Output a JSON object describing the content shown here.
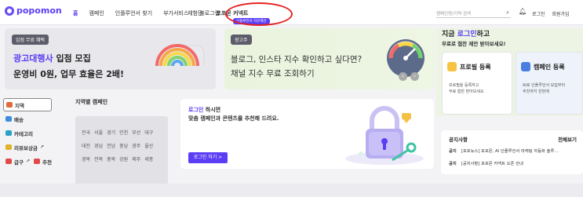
{
  "header": {
    "logo": "popomon",
    "nav": [
      "홈",
      "캠페인",
      "인플루언서 찾기",
      "부가서비스",
      "블로그랩",
      "체험단",
      "포포몬 커넥트"
    ],
    "sub_pill": "인플루언서 자유제안",
    "search_placeholder": "캠페인명/지역 검색",
    "links": [
      "로그인",
      "회원가입"
    ]
  },
  "banner1": {
    "tag": "입점 무료 혜택",
    "line1_accent": "광고대행사",
    "line1_rest": " 입점 모집",
    "line2": "운영비 0원, 업무 효율은 2배!"
  },
  "banner2": {
    "tag": "광고주",
    "line1": "블로그, 인스타 지수 확인하고 싶다면?",
    "line2": "채널 지수 무료 조회하기"
  },
  "right": {
    "title_pre": "지금 ",
    "title_accent": "로그인",
    "title_post": "하고",
    "subtitle": "무료로 협찬 제안 받아보세요!",
    "profile_card": {
      "title": "프로필 등록",
      "desc1": "프로필을 등록하고",
      "desc2": "무료 협찬 받아보세요"
    },
    "campaign_card": {
      "title": "캠페인 등록",
      "desc1": "AI로 인플루언서 모집부터",
      "desc2": "추천까지 한번에"
    }
  },
  "sidebar": {
    "items": [
      {
        "label": "지역",
        "color": "#e06a3a"
      },
      {
        "label": "배송",
        "color": "#3b8dde"
      },
      {
        "label": "카테고리",
        "color": "#2ba0c8"
      },
      {
        "label": "리뷰보상금",
        "color": "#e0b22c"
      },
      {
        "label": "급구",
        "color": "#e04a4a"
      },
      {
        "label": "추천",
        "color": "#e04a4a"
      }
    ]
  },
  "region": {
    "title": "지역별 캠페인",
    "rows": [
      [
        "전국",
        "서울",
        "경기",
        "인천",
        "부산",
        "대구"
      ],
      [
        "대전",
        "경남",
        "전남",
        "충남",
        "광주",
        "울산"
      ],
      [
        "경북",
        "전북",
        "충북",
        "강원",
        "제주",
        "세종"
      ]
    ]
  },
  "login_box": {
    "line1_accent": "로그인",
    "line1_rest": " 하시면",
    "line2": "맞춤 캠페인과 콘텐츠를 추천해 드려요.",
    "button": "로그인 하기 >"
  },
  "notice": {
    "title": "공지사항",
    "more": "전체보기",
    "items": [
      {
        "tag": "공지",
        "text": "[포포뉴스] 포포몬, AI 인플루언서 마케팅 자동화 솔루..."
      },
      {
        "tag": "공지",
        "text": "[공지사항] 포포몬 커넥트 오픈 안내"
      }
    ]
  },
  "colors": {
    "accent": "#5b3df5",
    "highlight_circle": "#e32222"
  }
}
